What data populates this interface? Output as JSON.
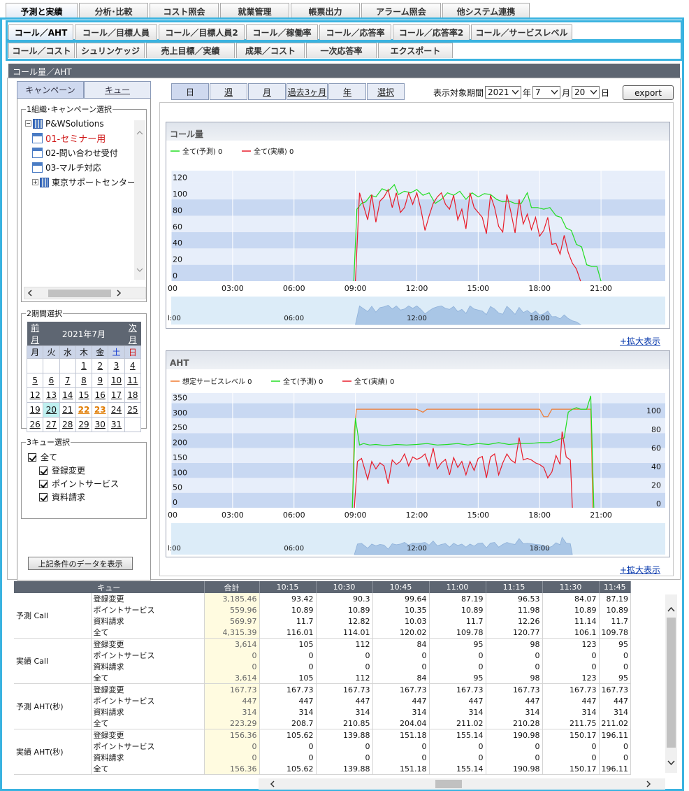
{
  "tabs_main": [
    {
      "label": "予測と実績",
      "w": 103,
      "on": true
    },
    {
      "label": "分析･比較",
      "w": 99
    },
    {
      "label": "コスト照会",
      "w": 99
    },
    {
      "label": "就業管理",
      "w": 99
    },
    {
      "label": "帳票出力",
      "w": 99
    },
    {
      "label": "アラーム照会",
      "w": 114
    },
    {
      "label": "他システム連携",
      "w": 125
    }
  ],
  "tabs_sub1": [
    {
      "label": "コール／AHT",
      "w": 93,
      "on": true
    },
    {
      "label": "コール／目標人員",
      "w": 118
    },
    {
      "label": "コール／目標人員2",
      "w": 123
    },
    {
      "label": "コール／稼働率",
      "w": 103
    },
    {
      "label": "コール／応答率",
      "w": 103
    },
    {
      "label": "コール／応答率2",
      "w": 110
    },
    {
      "label": "コール／サービスレベル",
      "w": 145
    }
  ],
  "tabs_sub2": [
    {
      "label": "コール／コスト",
      "w": 95
    },
    {
      "label": "シュリンケッジ",
      "w": 98
    },
    {
      "label": "売上目標／実績",
      "w": 127
    },
    {
      "label": "成果／コスト",
      "w": 98
    },
    {
      "label": "一次応答率",
      "w": 101
    },
    {
      "label": "エクスポート",
      "w": 107
    }
  ],
  "panel_title": "コール量／AHT",
  "left_tabs": [
    "キャンペーン",
    "キュー"
  ],
  "group1": "1組織･キャンペーン選択",
  "tree": {
    "root": "P&WSolutions",
    "items": [
      "01-セミナー用",
      "02-問い合わせ受付",
      "03-マルチ対応"
    ],
    "center": "東京サポートセンター"
  },
  "group2": "2期間選択",
  "calendar": {
    "prev": "前月",
    "month": "2021年7月",
    "next": "次月",
    "weekdays": [
      "月",
      "火",
      "水",
      "木",
      "金",
      "土",
      "日"
    ],
    "weeks": [
      [
        "",
        "",
        "",
        "1",
        "2",
        "3",
        "4"
      ],
      [
        "5",
        "6",
        "7",
        "8",
        "9",
        "10",
        "11"
      ],
      [
        "12",
        "13",
        "14",
        "15",
        "16",
        "17",
        "18"
      ],
      [
        "19",
        "20",
        "21",
        "22",
        "23",
        "24",
        "25"
      ],
      [
        "26",
        "27",
        "28",
        "29",
        "30",
        "31",
        ""
      ]
    ]
  },
  "group3": "3キュー選択",
  "queues": [
    "全て",
    "登録変更",
    "ポイントサービス",
    "資料請求"
  ],
  "show_button": "上記条件のデータを表示",
  "period_tabs": [
    "日",
    "週",
    "月",
    "過去3ヶ月",
    "年",
    "選択"
  ],
  "period": {
    "label": "表示対象期間",
    "year": "2021",
    "year_unit": "年",
    "month": "7",
    "month_unit": "月",
    "day": "20",
    "day_unit": "日"
  },
  "export": "export",
  "zoom": "+拡大表示",
  "chart_data": [
    {
      "type": "line",
      "title": "コール量",
      "legend": [
        "全て(予測) 0",
        "全て(実績) 0"
      ],
      "colors": [
        "#22dd22",
        "#e81c2a"
      ],
      "ylim": [
        0,
        130
      ],
      "yticks": [
        0,
        20,
        40,
        60,
        80,
        100,
        120
      ],
      "xticks": [
        "00",
        "03:00",
        "06:00",
        "09:00",
        "12:00",
        "15:00",
        "18:00",
        "21:00"
      ],
      "nav_ticks": [
        "l:00",
        "06:00",
        "12:00",
        "18:00"
      ],
      "forecast": [
        [
          8.92,
          0
        ],
        [
          9.07,
          88
        ],
        [
          9.3,
          95
        ],
        [
          9.5,
          97
        ],
        [
          9.75,
          105
        ],
        [
          10,
          103
        ],
        [
          10.3,
          113
        ],
        [
          10.6,
          110
        ],
        [
          10.9,
          118
        ],
        [
          11.1,
          106
        ],
        [
          11.4,
          110
        ],
        [
          11.7,
          108
        ],
        [
          12,
          112
        ],
        [
          12.3,
          105
        ],
        [
          12.6,
          108
        ],
        [
          12.9,
          95
        ],
        [
          13.2,
          100
        ],
        [
          13.5,
          108
        ],
        [
          13.8,
          105
        ],
        [
          14.1,
          110
        ],
        [
          14.4,
          100
        ],
        [
          14.7,
          108
        ],
        [
          15,
          103
        ],
        [
          15.3,
          107
        ],
        [
          15.6,
          106
        ],
        [
          15.9,
          100
        ],
        [
          16.2,
          97
        ],
        [
          16.5,
          98
        ],
        [
          16.8,
          95
        ],
        [
          17.1,
          95
        ],
        [
          17.4,
          108
        ],
        [
          17.6,
          90
        ],
        [
          17.9,
          90
        ],
        [
          18.2,
          88
        ],
        [
          18.5,
          90
        ],
        [
          18.8,
          80
        ],
        [
          19.05,
          78
        ],
        [
          19.3,
          65
        ],
        [
          19.55,
          62
        ],
        [
          19.8,
          45
        ],
        [
          20.05,
          42
        ],
        [
          20.3,
          20
        ],
        [
          20.55,
          18
        ],
        [
          20.8,
          18
        ],
        [
          21.0,
          0
        ]
      ],
      "actual": [
        [
          9.0,
          0
        ],
        [
          9.2,
          108
        ],
        [
          9.4,
          92
        ],
        [
          9.6,
          75
        ],
        [
          9.8,
          106
        ],
        [
          10.0,
          72
        ],
        [
          10.2,
          98
        ],
        [
          10.4,
          103
        ],
        [
          10.6,
          112
        ],
        [
          10.8,
          90
        ],
        [
          11.0,
          108
        ],
        [
          11.2,
          84
        ],
        [
          11.4,
          90
        ],
        [
          11.6,
          108
        ],
        [
          11.8,
          94
        ],
        [
          12,
          108
        ],
        [
          12.2,
          88
        ],
        [
          12.4,
          62
        ],
        [
          12.6,
          80
        ],
        [
          12.8,
          95
        ],
        [
          13.0,
          103
        ],
        [
          13.2,
          108
        ],
        [
          13.4,
          94
        ],
        [
          13.6,
          88
        ],
        [
          13.8,
          105
        ],
        [
          14.0,
          75
        ],
        [
          14.2,
          88
        ],
        [
          14.4,
          64
        ],
        [
          14.6,
          108
        ],
        [
          14.8,
          90
        ],
        [
          15.0,
          84
        ],
        [
          15.2,
          78
        ],
        [
          15.4,
          58
        ],
        [
          15.6,
          105
        ],
        [
          15.8,
          90
        ],
        [
          16.0,
          67
        ],
        [
          16.2,
          60
        ],
        [
          16.4,
          106
        ],
        [
          16.6,
          84
        ],
        [
          16.8,
          59
        ],
        [
          17.0,
          100
        ],
        [
          17.2,
          70
        ],
        [
          17.4,
          82
        ],
        [
          17.6,
          63
        ],
        [
          17.8,
          78
        ],
        [
          18.0,
          55
        ],
        [
          18.2,
          62
        ],
        [
          18.4,
          78
        ],
        [
          18.6,
          45
        ],
        [
          18.8,
          46
        ],
        [
          19.0,
          33
        ],
        [
          19.2,
          56
        ],
        [
          19.4,
          35
        ],
        [
          19.6,
          22
        ],
        [
          19.8,
          15
        ],
        [
          20.0,
          0
        ]
      ]
    },
    {
      "type": "line",
      "title": "AHT",
      "legend": [
        "想定サービスレベル 0",
        "全て(予測) 0",
        "全て(実績) 0"
      ],
      "colors": [
        "#f07a30",
        "#22dd22",
        "#e81c2a"
      ],
      "ylim": [
        0,
        370
      ],
      "yticks": [
        0,
        50,
        100,
        150,
        200,
        250,
        300,
        350
      ],
      "y2ticks": [
        0,
        20,
        40,
        60,
        80,
        100
      ],
      "xticks": [
        "00",
        "03:00",
        "06:00",
        "09:00",
        "12:00",
        "15:00",
        "18:00",
        "21:00"
      ],
      "nav_ticks": [
        "l:00",
        "06:00",
        "12:00",
        "18:00"
      ],
      "service_level": [
        [
          8.85,
          0
        ],
        [
          8.95,
          260
        ],
        [
          9.05,
          330
        ],
        [
          9.3,
          330
        ],
        [
          12.0,
          330
        ],
        [
          12.3,
          320
        ],
        [
          12.5,
          330
        ],
        [
          18.0,
          330
        ],
        [
          18.2,
          305
        ],
        [
          18.4,
          305
        ],
        [
          18.6,
          330
        ],
        [
          19.2,
          330
        ],
        [
          19.4,
          330
        ],
        [
          19.6,
          330
        ],
        [
          20.0,
          330
        ],
        [
          20.5,
          330
        ],
        [
          20.6,
          0
        ]
      ],
      "forecast": [
        [
          8.85,
          0
        ],
        [
          9.0,
          300
        ],
        [
          9.2,
          210
        ],
        [
          9.4,
          215
        ],
        [
          9.7,
          210
        ],
        [
          10,
          212
        ],
        [
          10.5,
          208
        ],
        [
          11,
          212
        ],
        [
          11.5,
          210
        ],
        [
          12,
          212
        ],
        [
          12.5,
          215
        ],
        [
          13,
          210
        ],
        [
          13.5,
          212
        ],
        [
          14,
          215
        ],
        [
          14.5,
          210
        ],
        [
          15,
          215
        ],
        [
          15.5,
          212
        ],
        [
          16,
          218
        ],
        [
          16.5,
          212
        ],
        [
          17,
          215
        ],
        [
          17.5,
          215
        ],
        [
          18,
          218
        ],
        [
          18.5,
          218
        ],
        [
          18.8,
          225
        ],
        [
          19.0,
          230
        ],
        [
          19.2,
          234
        ],
        [
          19.4,
          320
        ],
        [
          19.6,
          330
        ],
        [
          19.8,
          335
        ],
        [
          20.0,
          330
        ],
        [
          20.3,
          330
        ],
        [
          20.5,
          375
        ],
        [
          20.65,
          0
        ]
      ],
      "actual": [
        [
          8.95,
          0
        ],
        [
          9.1,
          155
        ],
        [
          9.3,
          165
        ],
        [
          9.6,
          95
        ],
        [
          9.8,
          155
        ],
        [
          10,
          130
        ],
        [
          10.2,
          150
        ],
        [
          10.4,
          140
        ],
        [
          10.6,
          80
        ],
        [
          10.8,
          160
        ],
        [
          11,
          145
        ],
        [
          11.2,
          155
        ],
        [
          11.4,
          180
        ],
        [
          11.6,
          140
        ],
        [
          11.8,
          170
        ],
        [
          12,
          162
        ],
        [
          12.2,
          168
        ],
        [
          12.4,
          180
        ],
        [
          12.6,
          140
        ],
        [
          12.8,
          200
        ],
        [
          13,
          130
        ],
        [
          13.2,
          150
        ],
        [
          13.4,
          162
        ],
        [
          13.6,
          110
        ],
        [
          13.8,
          168
        ],
        [
          14,
          135
        ],
        [
          14.2,
          155
        ],
        [
          14.4,
          110
        ],
        [
          14.6,
          155
        ],
        [
          14.8,
          125
        ],
        [
          15.0,
          165
        ],
        [
          15.2,
          172
        ],
        [
          15.4,
          100
        ],
        [
          15.6,
          170
        ],
        [
          15.8,
          180
        ],
        [
          16.0,
          110
        ],
        [
          16.2,
          150
        ],
        [
          16.4,
          180
        ],
        [
          16.6,
          160
        ],
        [
          16.8,
          150
        ],
        [
          17.0,
          235
        ],
        [
          17.2,
          160
        ],
        [
          17.4,
          165
        ],
        [
          17.6,
          160
        ],
        [
          17.8,
          150
        ],
        [
          18.0,
          145
        ],
        [
          18.2,
          135
        ],
        [
          18.4,
          100
        ],
        [
          18.6,
          120
        ],
        [
          18.8,
          175
        ],
        [
          19.0,
          145
        ],
        [
          19.1,
          255
        ],
        [
          19.3,
          170
        ],
        [
          19.5,
          160
        ],
        [
          19.6,
          0
        ]
      ]
    }
  ],
  "table": {
    "headers": [
      "キュー",
      "合計",
      "10:15",
      "10:30",
      "10:45",
      "11:00",
      "11:15",
      "11:30",
      "11:45"
    ],
    "groups": [
      {
        "name": "予測 Call",
        "rows": [
          [
            "登録変更",
            "3,185.46",
            "93.42",
            "90.3",
            "99.64",
            "87.19",
            "96.53",
            "84.07",
            "87.19"
          ],
          [
            "ポイントサービス",
            "559.96",
            "10.89",
            "10.89",
            "10.35",
            "10.89",
            "11.98",
            "10.89",
            "10.89"
          ],
          [
            "資料請求",
            "569.97",
            "11.7",
            "12.82",
            "10.03",
            "11.7",
            "12.26",
            "11.14",
            "11.7"
          ],
          [
            "全て",
            "4,315.39",
            "116.01",
            "114.01",
            "120.02",
            "109.78",
            "120.77",
            "106.1",
            "109.78"
          ]
        ]
      },
      {
        "name": "実績 Call",
        "rows": [
          [
            "登録変更",
            "3,614",
            "105",
            "112",
            "84",
            "95",
            "98",
            "123",
            "95"
          ],
          [
            "ポイントサービス",
            "0",
            "0",
            "0",
            "0",
            "0",
            "0",
            "0",
            "0"
          ],
          [
            "資料請求",
            "0",
            "0",
            "0",
            "0",
            "0",
            "0",
            "0",
            "0"
          ],
          [
            "全て",
            "3,614",
            "105",
            "112",
            "84",
            "95",
            "98",
            "123",
            "95"
          ]
        ]
      },
      {
        "name": "予測 AHT(秒)",
        "rows": [
          [
            "登録変更",
            "167.73",
            "167.73",
            "167.73",
            "167.73",
            "167.73",
            "167.73",
            "167.73",
            "167.73"
          ],
          [
            "ポイントサービス",
            "447",
            "447",
            "447",
            "447",
            "447",
            "447",
            "447",
            "447"
          ],
          [
            "資料請求",
            "314",
            "314",
            "314",
            "314",
            "314",
            "314",
            "314",
            "314"
          ],
          [
            "全て",
            "223.29",
            "208.7",
            "210.85",
            "204.04",
            "211.02",
            "210.28",
            "211.75",
            "211.02"
          ]
        ]
      },
      {
        "name": "実績 AHT(秒)",
        "rows": [
          [
            "登録変更",
            "156.36",
            "105.62",
            "139.88",
            "151.18",
            "155.14",
            "190.98",
            "150.17",
            "196.11"
          ],
          [
            "ポイントサービス",
            "0",
            "0",
            "0",
            "0",
            "0",
            "0",
            "0",
            "0"
          ],
          [
            "資料請求",
            "0",
            "0",
            "0",
            "0",
            "0",
            "0",
            "0",
            "0"
          ],
          [
            "全て",
            "156.36",
            "105.62",
            "139.88",
            "151.18",
            "155.14",
            "190.98",
            "150.17",
            "196.11"
          ]
        ]
      }
    ]
  }
}
